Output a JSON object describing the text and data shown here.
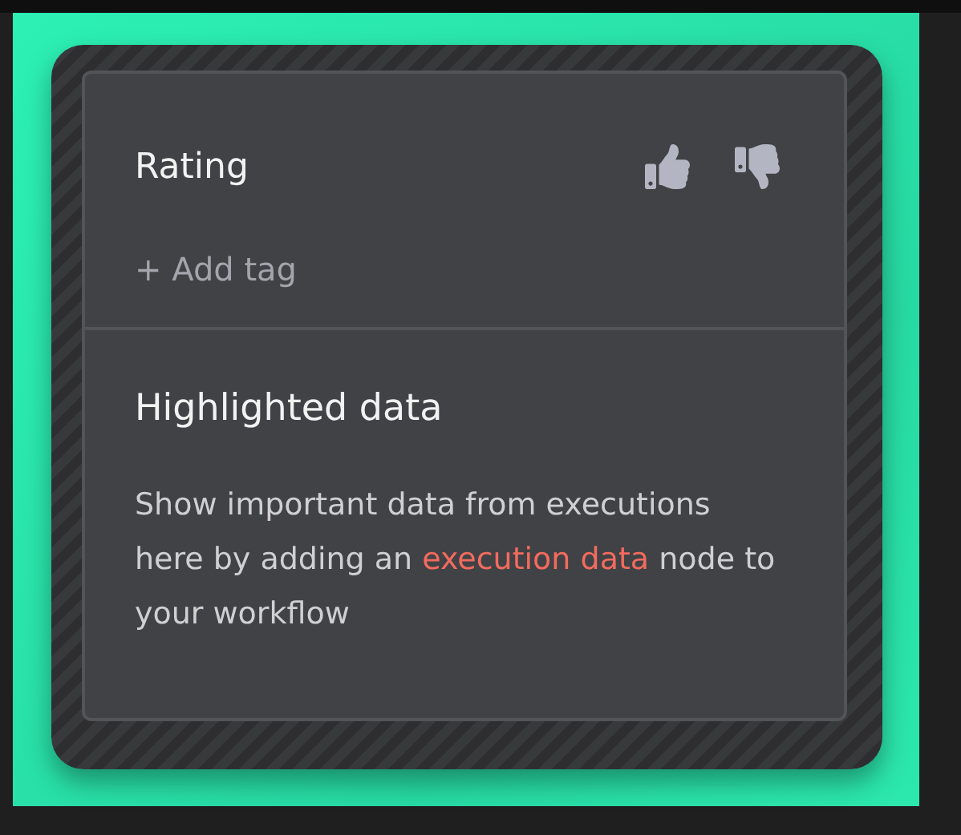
{
  "rating": {
    "label": "Rating"
  },
  "tags": {
    "add_label": "+ Add tag"
  },
  "highlighted_data": {
    "title": "Highlighted data",
    "description": {
      "before": "Show important data from executions here by adding an",
      "link": "execution data",
      "after": "node to your workflow"
    }
  }
}
